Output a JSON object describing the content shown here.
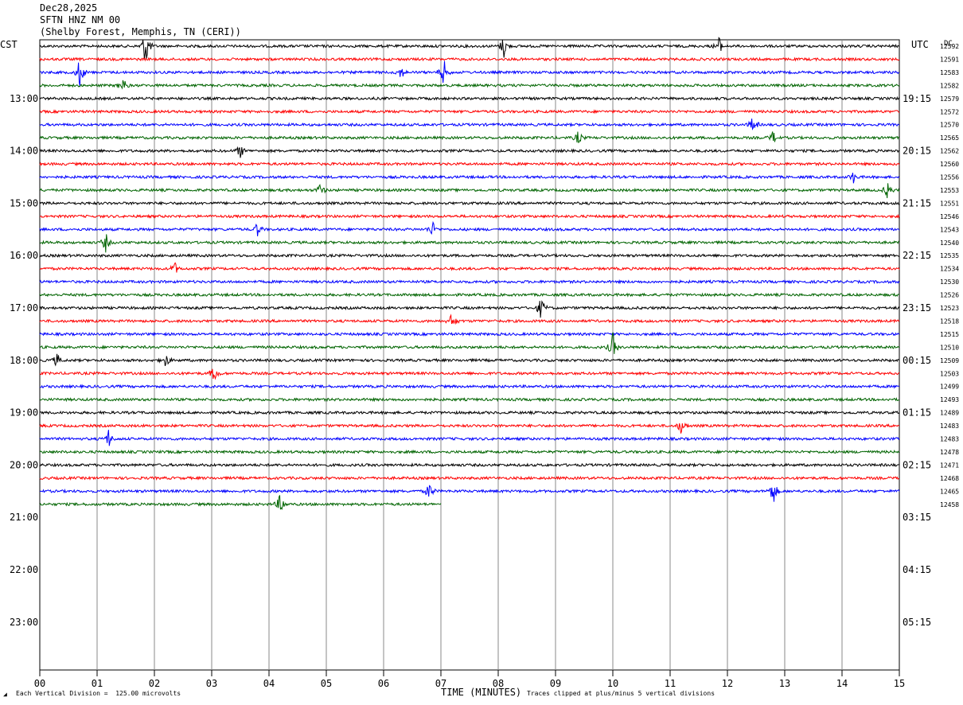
{
  "header": {
    "date": "Dec28,2025",
    "station": "SFTN HNZ NM 00",
    "location": "(Shelby Forest, Memphis, TN (CERI))"
  },
  "labels": {
    "left_tz": "CST",
    "right_tz": "UTC",
    "dc": "DC",
    "xlabel": "TIME (MINUTES)",
    "scale_note": "Each Vertical Division =  125.00 microvolts",
    "clip_note": "Traces clipped at plus/minus 5 vertical divisions"
  },
  "chart_data": {
    "type": "line",
    "title": "SFTN HNZ NM 00",
    "xlabel": "TIME (MINUTES)",
    "xlim": [
      0,
      15
    ],
    "x_ticks": [
      "00",
      "01",
      "02",
      "03",
      "04",
      "05",
      "06",
      "07",
      "08",
      "09",
      "10",
      "11",
      "12",
      "13",
      "14",
      "15"
    ],
    "left_time_labels": [
      "13:00",
      "14:00",
      "15:00",
      "16:00",
      "17:00",
      "18:00",
      "19:00",
      "20:00",
      "21:00",
      "22:00",
      "23:00"
    ],
    "right_time_labels": [
      "19:15",
      "20:15",
      "21:15",
      "22:15",
      "23:15",
      "00:15",
      "01:15",
      "02:15",
      "03:15",
      "04:15",
      "05:15"
    ],
    "trace_colors": [
      "#000000",
      "#ff0000",
      "#0000ff",
      "#006400"
    ],
    "row_dc_values": [
      "12592",
      "12591",
      "12583",
      "12582",
      "12579",
      "12572",
      "12570",
      "12565",
      "12562",
      "12560",
      "12556",
      "12553",
      "12551",
      "12546",
      "12543",
      "12540",
      "12535",
      "12534",
      "12530",
      "12526",
      "12523",
      "12518",
      "12515",
      "12510",
      "12509",
      "12503",
      "12499",
      "12493",
      "12489",
      "12483",
      "12483",
      "12478",
      "12471",
      "12468",
      "12465",
      "12458"
    ],
    "rows_per_hour": 4,
    "minutes_per_row": 15,
    "last_row_end_minute": 7,
    "events": [
      {
        "row": 0,
        "minute": 1.85,
        "amp": 5
      },
      {
        "row": 0,
        "minute": 8.1,
        "amp": 2.5
      },
      {
        "row": 0,
        "minute": 11.85,
        "amp": 2
      },
      {
        "row": 2,
        "minute": 0.7,
        "amp": 3.5
      },
      {
        "row": 2,
        "minute": 7.05,
        "amp": 3
      },
      {
        "row": 2,
        "minute": 6.3,
        "amp": 1.5
      },
      {
        "row": 3,
        "minute": 1.45,
        "amp": 1.8
      },
      {
        "row": 6,
        "minute": 12.45,
        "amp": 2
      },
      {
        "row": 7,
        "minute": 9.4,
        "amp": 1.5
      },
      {
        "row": 7,
        "minute": 12.8,
        "amp": 1.5
      },
      {
        "row": 8,
        "minute": 3.5,
        "amp": 1.5
      },
      {
        "row": 10,
        "minute": 14.2,
        "amp": 1.2
      },
      {
        "row": 11,
        "minute": 14.8,
        "amp": 2
      },
      {
        "row": 11,
        "minute": 4.9,
        "amp": 1.5
      },
      {
        "row": 14,
        "minute": 6.85,
        "amp": 1.8
      },
      {
        "row": 14,
        "minute": 3.8,
        "amp": 1.5
      },
      {
        "row": 15,
        "minute": 1.15,
        "amp": 2
      },
      {
        "row": 17,
        "minute": 2.35,
        "amp": 1.5
      },
      {
        "row": 20,
        "minute": 8.75,
        "amp": 2.5
      },
      {
        "row": 21,
        "minute": 7.2,
        "amp": 2
      },
      {
        "row": 23,
        "minute": 10,
        "amp": 3
      },
      {
        "row": 24,
        "minute": 0.3,
        "amp": 1.5
      },
      {
        "row": 24,
        "minute": 2.2,
        "amp": 1.5
      },
      {
        "row": 25,
        "minute": 3.05,
        "amp": 2
      },
      {
        "row": 29,
        "minute": 11.2,
        "amp": 2
      },
      {
        "row": 30,
        "minute": 1.2,
        "amp": 2
      },
      {
        "row": 34,
        "minute": 12.8,
        "amp": 3
      },
      {
        "row": 34,
        "minute": 6.8,
        "amp": 2
      },
      {
        "row": 35,
        "minute": 4.2,
        "amp": 2.5
      }
    ]
  }
}
